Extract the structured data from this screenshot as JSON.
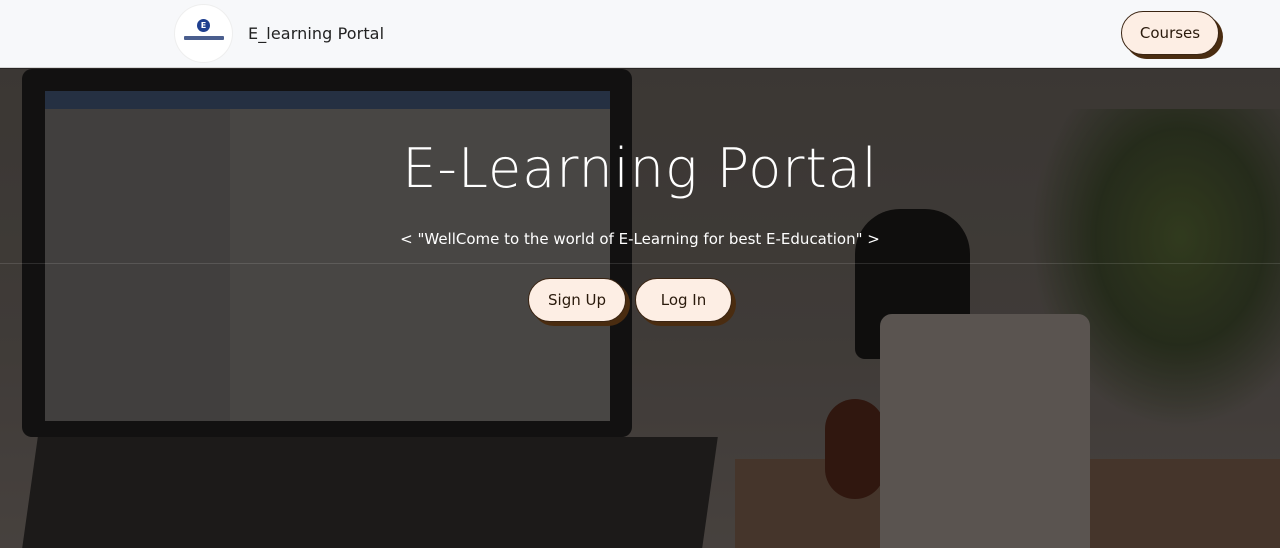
{
  "navbar": {
    "brand": "E_learning Portal",
    "logo_mark": "E",
    "courses_label": "Courses"
  },
  "hero": {
    "title": "E-Learning Portal",
    "tagline": "< \"WellCome to the world of E-Learning for best E-Education\" >",
    "signup_label": "Sign Up",
    "login_label": "Log In"
  },
  "colors": {
    "navbar_bg": "#f7f8fa",
    "button_bg": "#fdeee4",
    "button_shadow": "#4a2c10",
    "hero_text": "#ffffff"
  }
}
